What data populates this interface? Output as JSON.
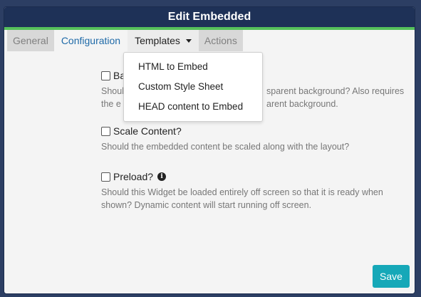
{
  "dialog": {
    "title": "Edit Embedded"
  },
  "tabs": [
    {
      "label": "General"
    },
    {
      "label": "Configuration"
    },
    {
      "label": "Templates"
    },
    {
      "label": "Actions"
    }
  ],
  "dropdown": {
    "items": [
      {
        "label": "HTML to Embed"
      },
      {
        "label": "Custom Style Sheet"
      },
      {
        "label": "HEAD content to Embed"
      }
    ]
  },
  "fields": {
    "background": {
      "label_visible": "Ba",
      "help_line1_left": "Shoul",
      "help_line1_right": "sparent background? Also requires",
      "help_line2_left": "the e",
      "help_line2_right": "arent background."
    },
    "scale": {
      "label": "Scale Content?",
      "help": "Should the embedded content be scaled along with the layout?"
    },
    "preload": {
      "label": "Preload?",
      "help": "Should this Widget be loaded entirely off screen so that it is ready when shown? Dynamic content will start running off screen."
    }
  },
  "footer": {
    "save_label": "Save"
  },
  "colors": {
    "title_bg": "#1e3157",
    "accent_green": "#56c15b",
    "save_bg": "#16a8b8",
    "link": "#1f6aa8"
  },
  "icons": {
    "info": "info-circle-icon",
    "caret": "caret-down-icon"
  }
}
